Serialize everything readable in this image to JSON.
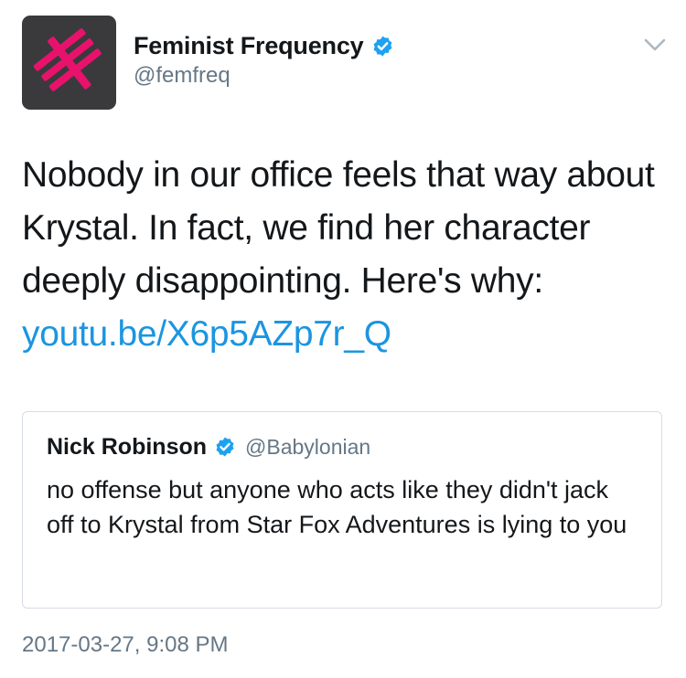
{
  "tweet": {
    "author": {
      "display_name": "Feminist Frequency",
      "handle": "@femfreq",
      "verified_icon": "verified-badge-icon",
      "avatar_icon": "feminist-frequency-logo"
    },
    "menu_icon": "chevron-down-icon",
    "text_part1": "Nobody in our office feels that way about Krystal. In fact, we find her character deeply disappointing. Here's why: ",
    "link_text": "youtu.be/X6p5AZp7r_Q",
    "timestamp": "2017-03-27, 9:08 PM"
  },
  "quoted_tweet": {
    "display_name": "Nick Robinson",
    "handle": "@Babylonian",
    "verified_icon": "verified-badge-icon",
    "text": "no offense but anyone who acts like they didn't jack off to Krystal from Star Fox Adventures is lying to you"
  },
  "colors": {
    "link": "#1b95e0",
    "verified": "#1da1f2",
    "secondary_text": "#657786",
    "logo_pink": "#e8126c",
    "avatar_bg": "#3a3a3c"
  }
}
